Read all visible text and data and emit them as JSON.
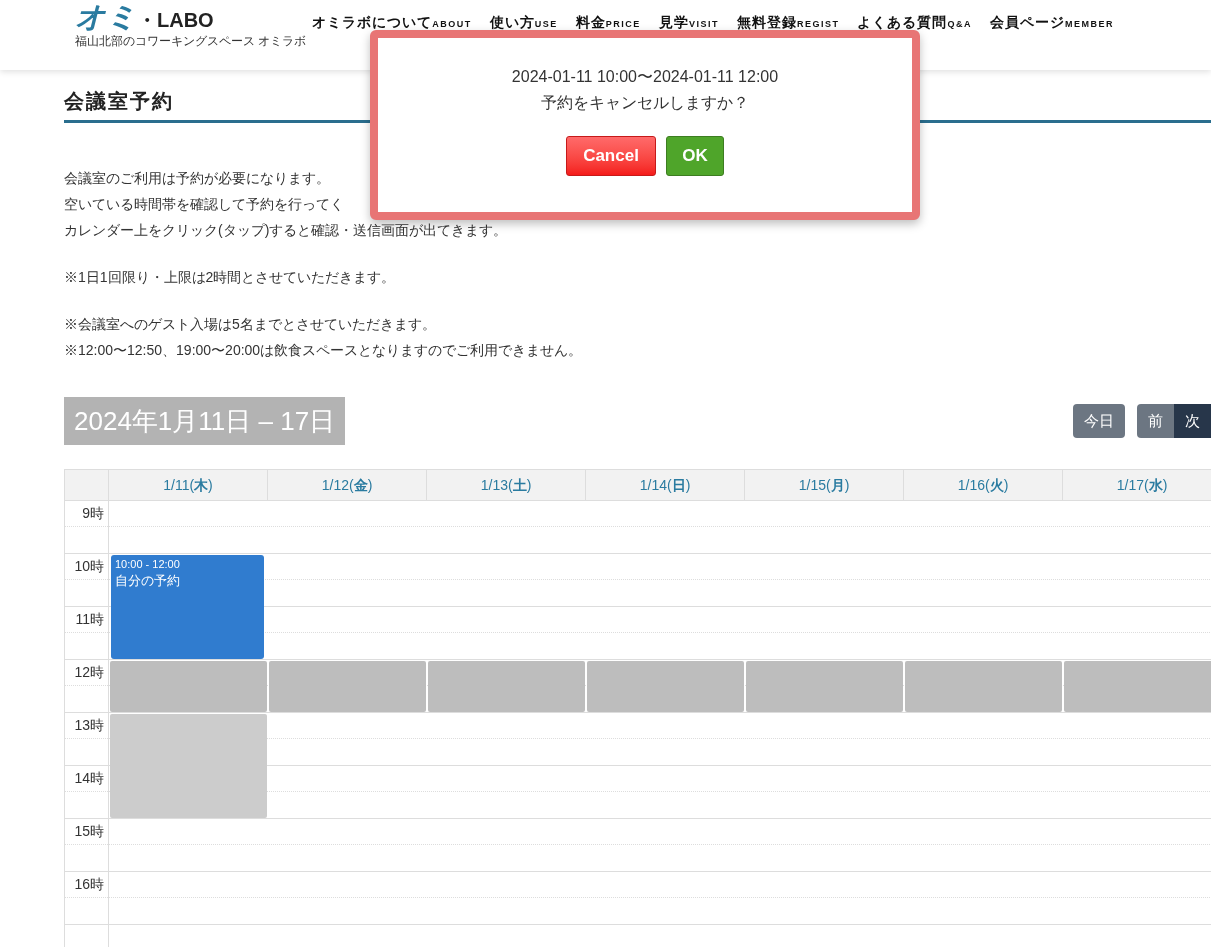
{
  "header": {
    "logo": {
      "mark": "オミ",
      "text": "・LABO",
      "tagline": "福山北部のコワーキングスペース オミラボ"
    },
    "nav": [
      {
        "ja": "オミラボについて",
        "en": "ABOUT"
      },
      {
        "ja": "使い方",
        "en": "USE"
      },
      {
        "ja": "料金",
        "en": "PRICE"
      },
      {
        "ja": "見学",
        "en": "VISIT"
      },
      {
        "ja": "無料登録",
        "en": "REGIST"
      },
      {
        "ja": "よくある質問",
        "en": "Q&A"
      },
      {
        "ja": "会員ページ",
        "en": "MEMBER"
      }
    ]
  },
  "page_title": "会議室予約",
  "paragraphs": [
    [
      "会議室のご利用は予約が必要になります。",
      "空いている時間帯を確認して予約を行ってく",
      "カレンダー上をクリック(タップ)すると確認・送信画面が出てきます。"
    ],
    [
      "※1日1回限り・上限は2時間とさせていただきます。"
    ],
    [
      "※会議室へのゲスト入場は5名までとさせていただきます。",
      "※12:00〜12:50、19:00〜20:00は飲食スペースとなりますのでご利用できません。"
    ]
  ],
  "calendar": {
    "range_title": "2024年1月11日 – 17日",
    "buttons": [
      {
        "label": "今日",
        "kind": "today",
        "active": false
      },
      {
        "label": "前",
        "kind": "prev",
        "active": false
      },
      {
        "label": "次",
        "kind": "next",
        "active": true
      }
    ],
    "hours": [
      "9時",
      "10時",
      "11時",
      "12時",
      "13時",
      "14時",
      "15時",
      "16時"
    ],
    "days": [
      {
        "label": "1/11(**木**)",
        "slots": [
          {
            "kind": "free"
          },
          {
            "kind": "mine"
          },
          {
            "kind": "mine"
          },
          {
            "kind": "closed"
          },
          {
            "kind": "booked"
          },
          {
            "kind": "booked"
          },
          {
            "kind": "free"
          },
          {
            "kind": "free"
          }
        ],
        "event": {
          "time": "10:00 - 12:00",
          "title": "自分の予約"
        }
      },
      {
        "label": "1/12(**金**)",
        "slots": [
          {
            "kind": "free"
          },
          {
            "kind": "free"
          },
          {
            "kind": "free"
          },
          {
            "kind": "closed"
          },
          {
            "kind": "free"
          },
          {
            "kind": "free"
          },
          {
            "kind": "free"
          },
          {
            "kind": "free"
          }
        ]
      },
      {
        "label": "1/13(**土**)",
        "slots": [
          {
            "kind": "free"
          },
          {
            "kind": "free"
          },
          {
            "kind": "free"
          },
          {
            "kind": "closed"
          },
          {
            "kind": "free"
          },
          {
            "kind": "free"
          },
          {
            "kind": "free"
          },
          {
            "kind": "free"
          }
        ]
      },
      {
        "label": "1/14(**日**)",
        "slots": [
          {
            "kind": "free"
          },
          {
            "kind": "free"
          },
          {
            "kind": "free"
          },
          {
            "kind": "closed"
          },
          {
            "kind": "free"
          },
          {
            "kind": "free"
          },
          {
            "kind": "free"
          },
          {
            "kind": "free"
          }
        ]
      },
      {
        "label": "1/15(**月**)",
        "slots": [
          {
            "kind": "free"
          },
          {
            "kind": "free"
          },
          {
            "kind": "free"
          },
          {
            "kind": "closed"
          },
          {
            "kind": "free"
          },
          {
            "kind": "free"
          },
          {
            "kind": "free"
          },
          {
            "kind": "free"
          }
        ]
      },
      {
        "label": "1/16(**火**)",
        "slots": [
          {
            "kind": "free"
          },
          {
            "kind": "free"
          },
          {
            "kind": "free"
          },
          {
            "kind": "closed"
          },
          {
            "kind": "free"
          },
          {
            "kind": "free"
          },
          {
            "kind": "free"
          },
          {
            "kind": "free"
          }
        ]
      },
      {
        "label": "1/17(**水**)",
        "slots": [
          {
            "kind": "free"
          },
          {
            "kind": "free"
          },
          {
            "kind": "free"
          },
          {
            "kind": "closed"
          },
          {
            "kind": "free"
          },
          {
            "kind": "free"
          },
          {
            "kind": "free"
          },
          {
            "kind": "free"
          }
        ]
      }
    ]
  },
  "dialog": {
    "lines": [
      "2024-01-11 10:00〜2024-01-11 12:00",
      "予約をキャンセルしますか？"
    ],
    "buttons": [
      {
        "label": "Cancel",
        "kind": "cancel"
      },
      {
        "label": "OK",
        "kind": "ok"
      }
    ]
  }
}
